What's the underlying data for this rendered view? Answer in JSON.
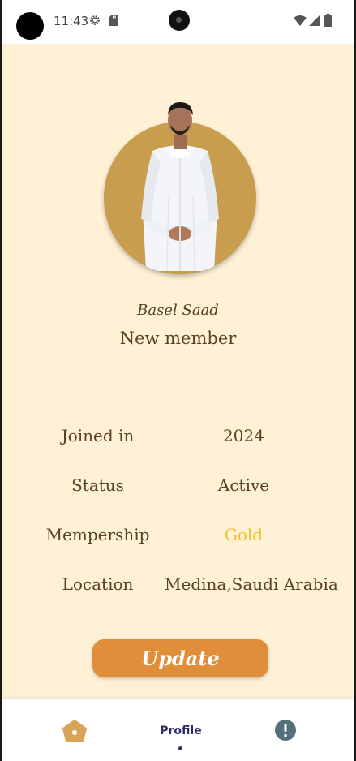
{
  "status_bar": {
    "time": "11:43",
    "icons": [
      "gear-icon",
      "sd-card-icon",
      "wifi-icon",
      "signal-icon",
      "battery-icon"
    ]
  },
  "profile": {
    "name": "Basel Saad",
    "rank": "New member"
  },
  "details": [
    {
      "label": "Joined in",
      "value": "2024"
    },
    {
      "label": "Status",
      "value": "Active"
    },
    {
      "label": "Mempership",
      "value": "Gold"
    },
    {
      "label": "Location",
      "value": "Medina,Saudi Arabia"
    }
  ],
  "update_button": {
    "label": "Update"
  },
  "bottom_nav": {
    "items": [
      {
        "icon": "home-icon"
      },
      {
        "label": "Profile",
        "active": true
      },
      {
        "icon": "info-icon"
      }
    ]
  },
  "colors": {
    "background": "#fff1d6",
    "text": "#5c4024",
    "gold": "#f2c12e",
    "button": "#e08e3a",
    "avatar_bg": "#c99d4e",
    "nav_active": "#2d2d6e",
    "home_icon": "#d9a45a",
    "info_icon": "#546e7a"
  }
}
